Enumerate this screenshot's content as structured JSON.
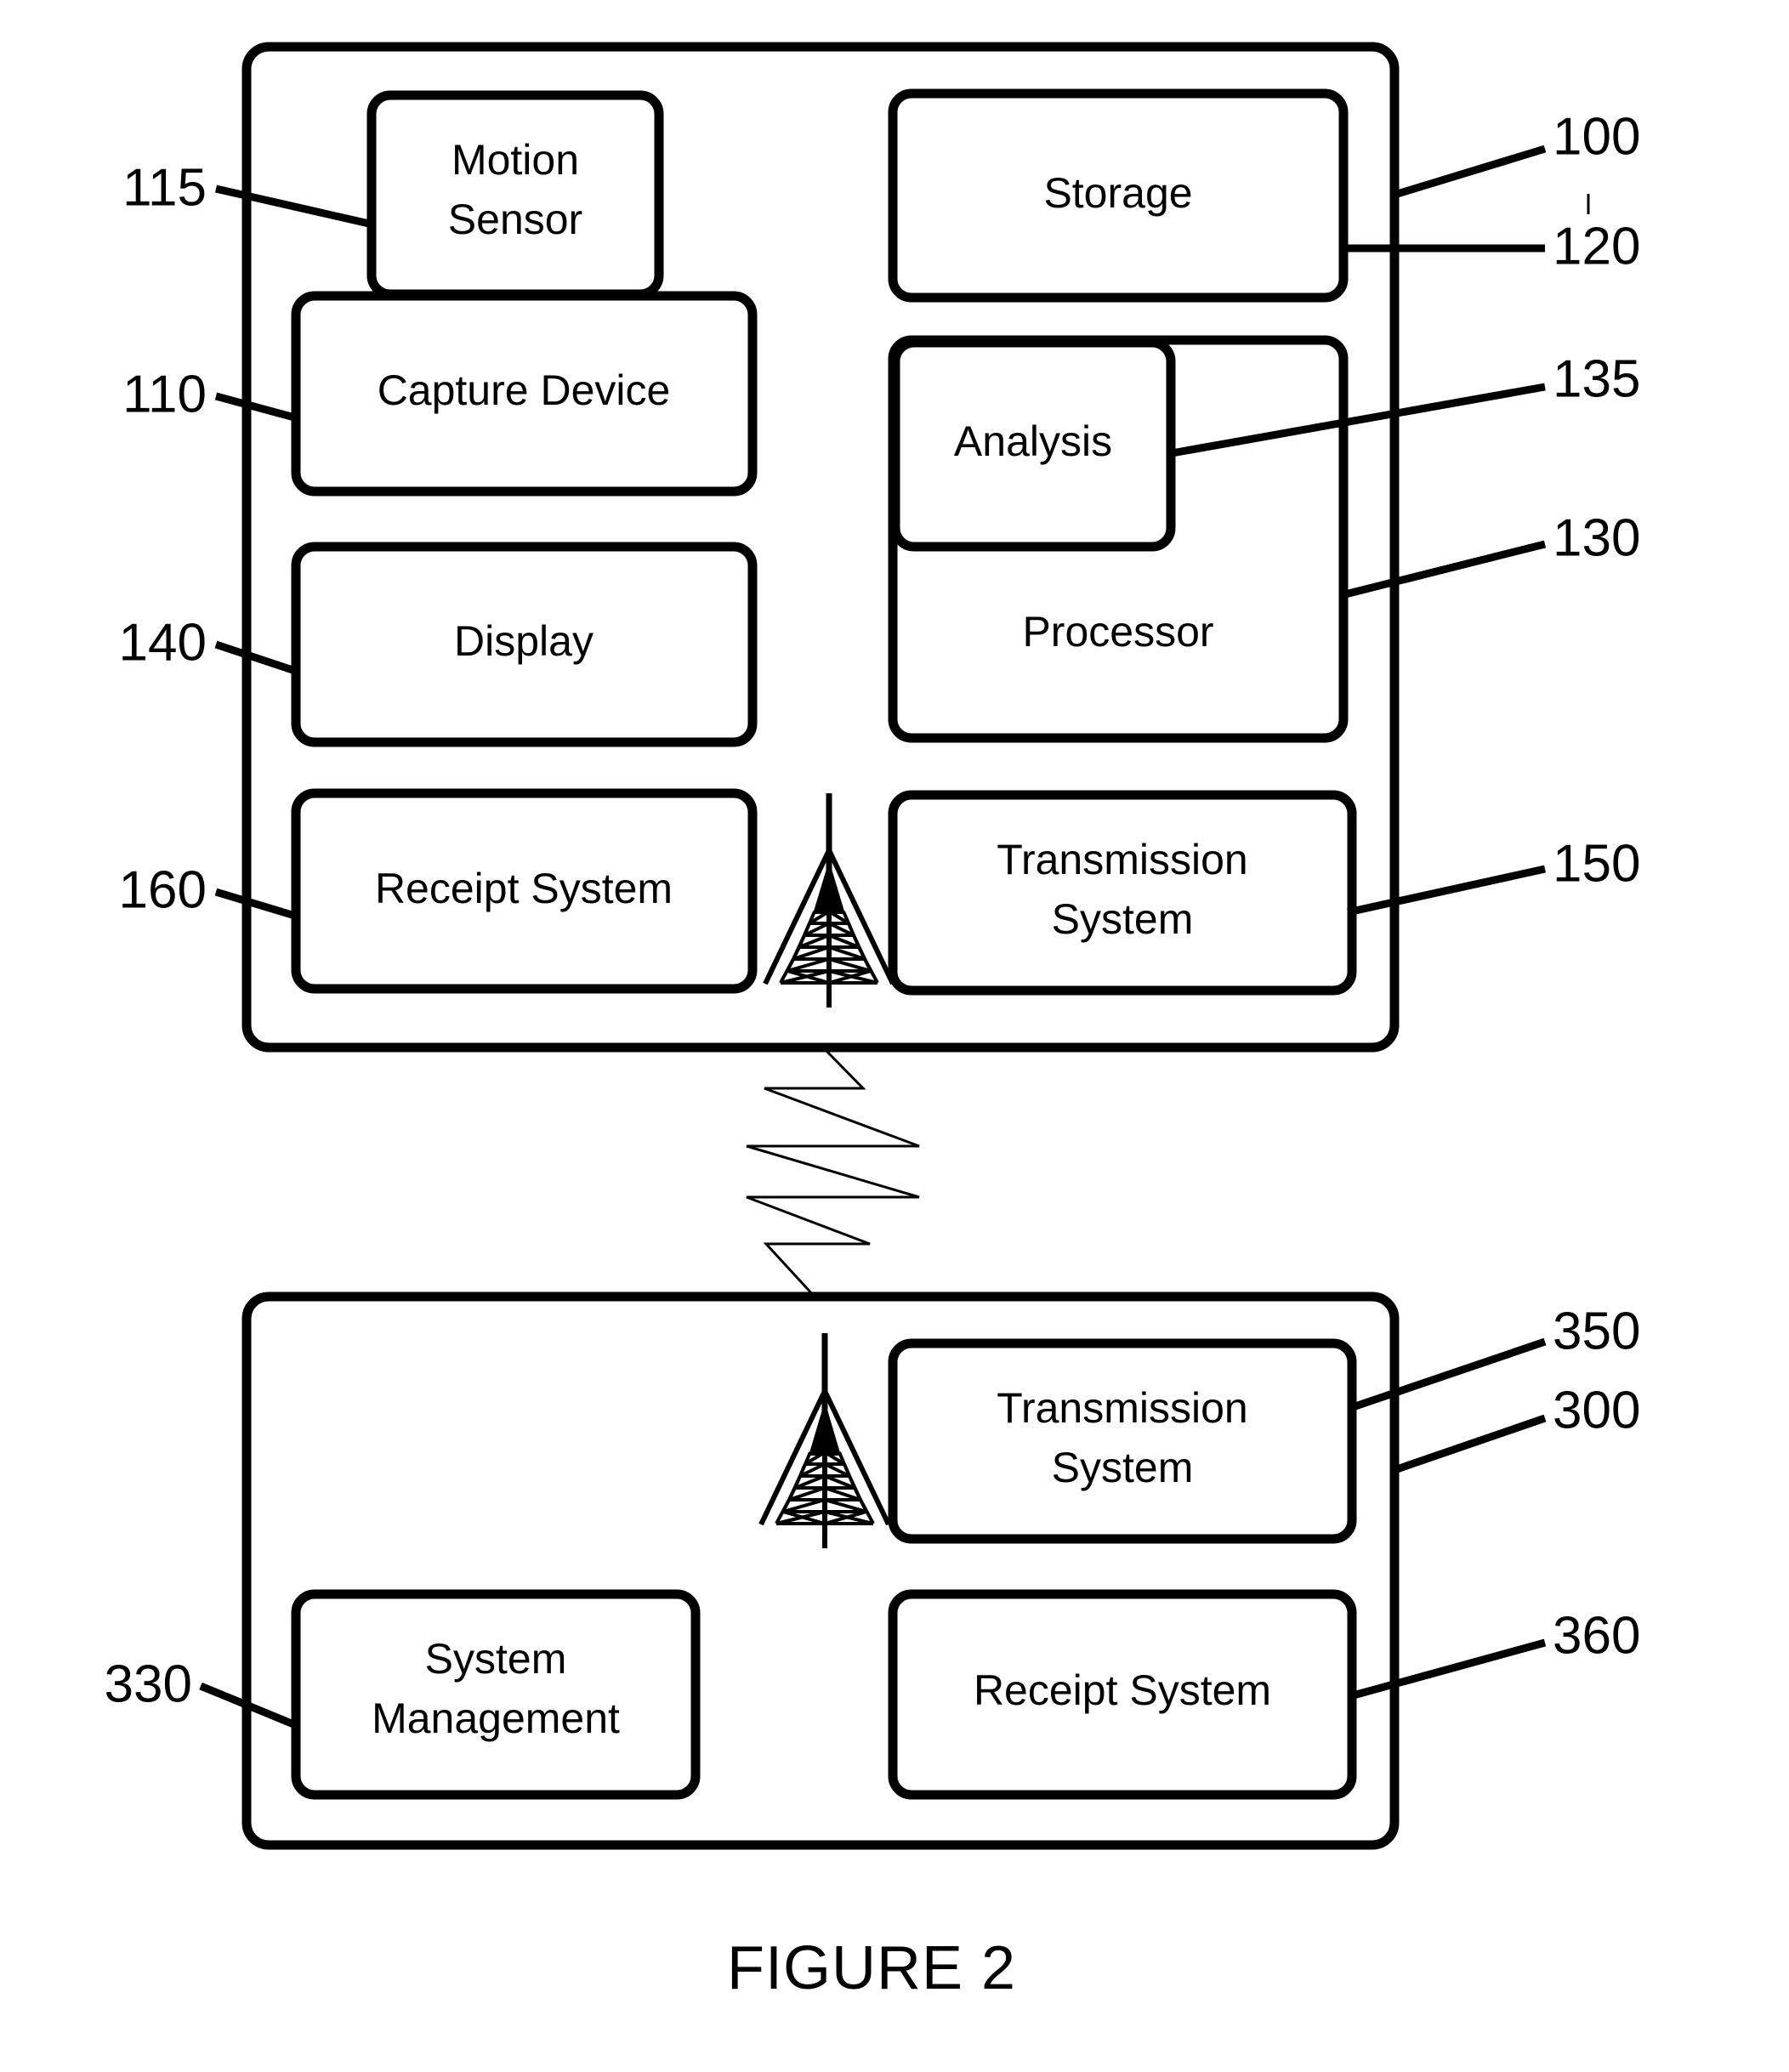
{
  "figure": {
    "caption": "FIGURE 2",
    "panels": [
      {
        "id": "capture-system",
        "ref": "100",
        "blocks": [
          {
            "id": "motion-sensor",
            "label": "Motion\nSensor",
            "line1": "Motion",
            "line2": "Sensor",
            "ref": "115"
          },
          {
            "id": "capture-device",
            "label": "Capture Device",
            "line1": "Capture Device",
            "line2": "",
            "ref": "110"
          },
          {
            "id": "display",
            "label": "Display",
            "line1": "Display",
            "line2": "",
            "ref": "140"
          },
          {
            "id": "receipt-system",
            "label": "Receipt System",
            "line1": "Receipt System",
            "line2": "",
            "ref": "160"
          },
          {
            "id": "storage",
            "label": "Storage",
            "line1": "Storage",
            "line2": "",
            "ref": "120"
          },
          {
            "id": "analysis",
            "label": "Analysis",
            "line1": "Analysis",
            "line2": "",
            "ref": "135"
          },
          {
            "id": "processor",
            "label": "Processor",
            "line1": "Processor",
            "line2": "",
            "ref": "130"
          },
          {
            "id": "transmission-system",
            "label": "Transmission\nSystem",
            "line1": "Transmission",
            "line2": "System",
            "ref": "150"
          }
        ]
      },
      {
        "id": "remote-system",
        "ref": "300",
        "blocks": [
          {
            "id": "transmission-system-2",
            "label": "Transmission\nSystem",
            "line1": "Transmission",
            "line2": "System",
            "ref": "350"
          },
          {
            "id": "system-management",
            "label": "System\nManagement",
            "line1": "System",
            "line2": "Management",
            "ref": "330"
          },
          {
            "id": "receipt-system-2",
            "label": "Receipt System",
            "line1": "Receipt System",
            "line2": "",
            "ref": "360"
          }
        ]
      }
    ],
    "icons": [
      {
        "id": "antenna-tower-top",
        "name": "radio-tower-icon"
      },
      {
        "id": "antenna-tower-bottom",
        "name": "radio-tower-icon"
      },
      {
        "id": "wireless-link",
        "name": "lightning-bolt-icon"
      }
    ],
    "reference_numerals": {
      "top_panel": "100",
      "storage": "120",
      "analysis": "135",
      "processor": "130",
      "motion_sensor": "115",
      "capture_device": "110",
      "display": "140",
      "receipt_system": "160",
      "transmission_system": "150",
      "bottom_panel": "300",
      "transmission_system_2": "350",
      "system_management": "330",
      "receipt_system_2": "360"
    },
    "colors": {
      "stroke": "#000000",
      "fill": "#ffffff",
      "background": "#ffffff"
    }
  }
}
